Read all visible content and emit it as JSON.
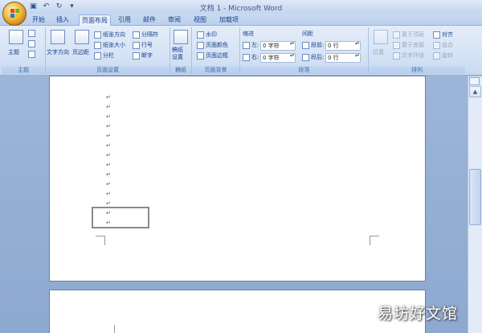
{
  "title_bar": {
    "title": "文档 1 - Microsoft Word"
  },
  "quick_access": {
    "save_icon": "save-icon",
    "undo_icon": "undo-icon",
    "redo_icon": "redo-icon",
    "customize": "▾"
  },
  "tabs": [
    {
      "label": "开始",
      "active": false
    },
    {
      "label": "插入",
      "active": false
    },
    {
      "label": "页面布局",
      "active": true
    },
    {
      "label": "引用",
      "active": false
    },
    {
      "label": "邮件",
      "active": false
    },
    {
      "label": "审阅",
      "active": false
    },
    {
      "label": "视图",
      "active": false
    },
    {
      "label": "加载项",
      "active": false
    }
  ],
  "ribbon": {
    "themes": {
      "theme_label": "主题",
      "group_label": "主题"
    },
    "page_setup": {
      "text_direction": "文字方向",
      "margins": "页边距",
      "orientation": "纸张方向",
      "size": "纸张大小",
      "columns": "分栏",
      "breaks": "分隔符",
      "line_numbers": "行号",
      "hyphenation": "断字",
      "group_label": "页面设置"
    },
    "draft": {
      "label": "稿纸\n设置",
      "group_label": "稿纸"
    },
    "page_background": {
      "watermark": "水印",
      "page_color": "页面颜色",
      "page_borders": "页面边框",
      "group_label": "页面背景"
    },
    "paragraph": {
      "indent_label": "缩进",
      "indent_left_label": "左:",
      "indent_left_value": "0 字符",
      "indent_right_label": "右:",
      "indent_right_value": "0 字符",
      "spacing_label": "间距",
      "spacing_before_label": "段前:",
      "spacing_before_value": "0 行",
      "spacing_after_label": "段后:",
      "spacing_after_value": "0 行",
      "group_label": "段落"
    },
    "arrange": {
      "position": "位置",
      "bring_front": "置于顶层",
      "send_back": "置于底层",
      "text_wrap": "文字环绕",
      "align": "对齐",
      "group": "组合",
      "rotate": "旋转",
      "group_label": "排列"
    }
  },
  "document": {
    "paragraph_mark": "↵"
  },
  "watermark_text": "易坊好文馆"
}
